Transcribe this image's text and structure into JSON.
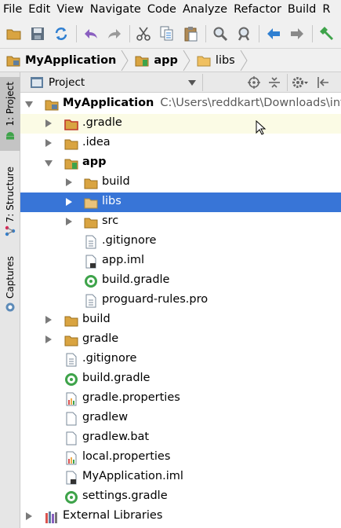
{
  "menu": [
    "File",
    "Edit",
    "View",
    "Navigate",
    "Code",
    "Analyze",
    "Refactor",
    "Build",
    "R"
  ],
  "toolbar": {
    "icons": [
      "open-folder-icon",
      "save-icon",
      "sync-icon",
      "undo-icon",
      "redo-icon",
      "cut-icon",
      "copy-icon",
      "paste-icon",
      "find-icon",
      "replace-icon",
      "back-icon",
      "forward-icon",
      "hammer-icon"
    ]
  },
  "breadcrumb": [
    "MyApplication",
    "app",
    "libs"
  ],
  "sidebar": {
    "tabs": [
      "1: Project",
      "7: Structure",
      "Captures"
    ]
  },
  "panel": {
    "title": "Project"
  },
  "tree": {
    "root_label": "MyApplication",
    "root_path": "C:\\Users\\reddkart\\Downloads\\intent",
    "items": [
      {
        "label": ".gradle"
      },
      {
        "label": ".idea"
      },
      {
        "label": "app"
      },
      {
        "label": "build"
      },
      {
        "label": "libs"
      },
      {
        "label": "src"
      },
      {
        "label": ".gitignore"
      },
      {
        "label": "app.iml"
      },
      {
        "label": "build.gradle"
      },
      {
        "label": "proguard-rules.pro"
      },
      {
        "label": "build"
      },
      {
        "label": "gradle"
      },
      {
        "label": ".gitignore"
      },
      {
        "label": "build.gradle"
      },
      {
        "label": "gradle.properties"
      },
      {
        "label": "gradlew"
      },
      {
        "label": "gradlew.bat"
      },
      {
        "label": "local.properties"
      },
      {
        "label": "MyApplication.iml"
      },
      {
        "label": "settings.gradle"
      },
      {
        "label": "External Libraries"
      }
    ]
  },
  "colors": {
    "selection": "#3875d7",
    "folder": "#d9a441",
    "gradle_green": "#3ea34a"
  }
}
